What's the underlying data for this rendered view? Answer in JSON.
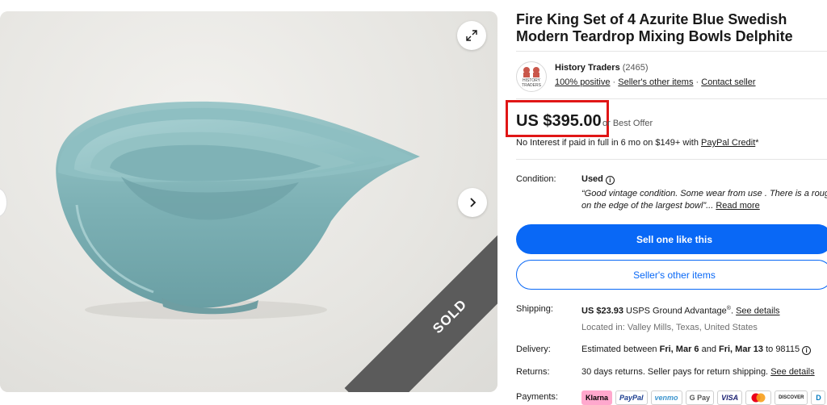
{
  "gallery": {
    "sold_label": "SOLD",
    "expand_icon": "expand-icon",
    "next_icon": "chevron-right-icon"
  },
  "listing": {
    "title": "Fire King Set of 4 Azurite Blue Swedish Modern Teardrop Mixing Bowls Delphite"
  },
  "seller": {
    "name": "History Traders",
    "count": "(2465)",
    "positive": "100% positive",
    "dot1": " · ",
    "other_items": "Seller's other items",
    "dot2": " · ",
    "contact": "Contact seller",
    "logo_text_line1": "HISTORY",
    "logo_text_line2": "TRADERS"
  },
  "price": {
    "amount": "US $395.00",
    "best_offer": "or Best Offer",
    "financing_prefix": "No Interest if paid in full in 6 mo on $149+ with ",
    "financing_link": "PayPal Credit",
    "financing_suffix": "*"
  },
  "condition": {
    "label": "Condition:",
    "value": "Used",
    "quote_line1": "“Good vintage condition. Some wear from use . There is a rough spot",
    "quote_line2": "on the edge of the largest bowl”...",
    "read_more": "Read more"
  },
  "actions": {
    "primary": "Sell one like this",
    "secondary": "Seller's other items"
  },
  "shipping": {
    "label": "Shipping:",
    "price": "US $23.93",
    "service": " USPS Ground Advantage",
    "reg": "®",
    "period": ". ",
    "details_link": "See details",
    "location": "Located in: Valley Mills, Texas, United States"
  },
  "delivery": {
    "label": "Delivery:",
    "prefix": "Estimated between ",
    "date1": "Fri, Mar 6",
    "and": " and ",
    "date2": "Fri, Mar 13",
    "suffix": " to 98115"
  },
  "returns": {
    "label": "Returns:",
    "text": "30 days returns. Seller pays for return shipping. ",
    "details_link": "See details"
  },
  "payments": {
    "label": "Payments:",
    "methods": [
      "Klarna",
      "PayPal",
      "venmo",
      "G Pay",
      "VISA",
      "",
      "DISCOVER",
      "D"
    ]
  },
  "colors": {
    "accent_blue": "#0968f6",
    "price_box_red": "#e01616",
    "bowl_teal": "#7fb2b6",
    "sold_ribbon": "#5b5b5b",
    "klarna_pink": "#ffa8cd"
  }
}
